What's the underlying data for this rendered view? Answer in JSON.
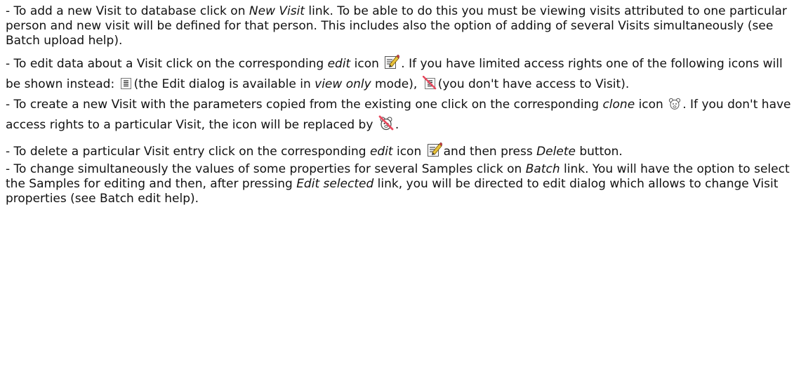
{
  "help": {
    "p1": {
      "t1": "- To add a new Visit to database click on ",
      "link": "New Visit",
      "t2": " link. To be able to do this you must be viewing visits attributed to one particular person and new visit will be defined for that person. This includes also the option of adding of several Visits simultaneously (see Batch upload help)."
    },
    "p2": {
      "t1": "- To edit data about a Visit click on the corresponding ",
      "edit": "edit",
      "t2": " icon ",
      "t3": ". If you have limited access rights one of the following icons will be shown instead: ",
      "t4": "(the Edit dialog is available in ",
      "view_only": "view only",
      "t5": " mode), ",
      "t6": "(you don't have access to Visit)."
    },
    "p3": {
      "t1": "- To create a new Visit with the parameters copied from the existing one click on the corresponding ",
      "clone": "clone",
      "t2": " icon ",
      "t3": ". If you don't have access rights to a particular Visit, the icon will be replaced by ",
      "t4": "."
    },
    "p4": {
      "t1": "- To delete a particular Visit entry click on the corresponding ",
      "edit": "edit",
      "t2": " icon ",
      "t3": "and then press ",
      "delete": "Delete",
      "t4": " button."
    },
    "p5": {
      "t1": "- To change simultaneously the values of some properties for several Samples click on ",
      "batch": "Batch",
      "t2": " link. You will have the option to select the Samples for editing and then, after pressing ",
      "edit_selected": "Edit selected",
      "t3": " link, you will be directed to edit dialog which allows to change Visit properties (see Batch edit help)."
    }
  },
  "icons": {
    "edit": "edit-icon",
    "view_only": "view-only-icon",
    "no_access": "no-access-icon",
    "clone": "clone-icon",
    "clone_denied": "clone-denied-icon"
  }
}
